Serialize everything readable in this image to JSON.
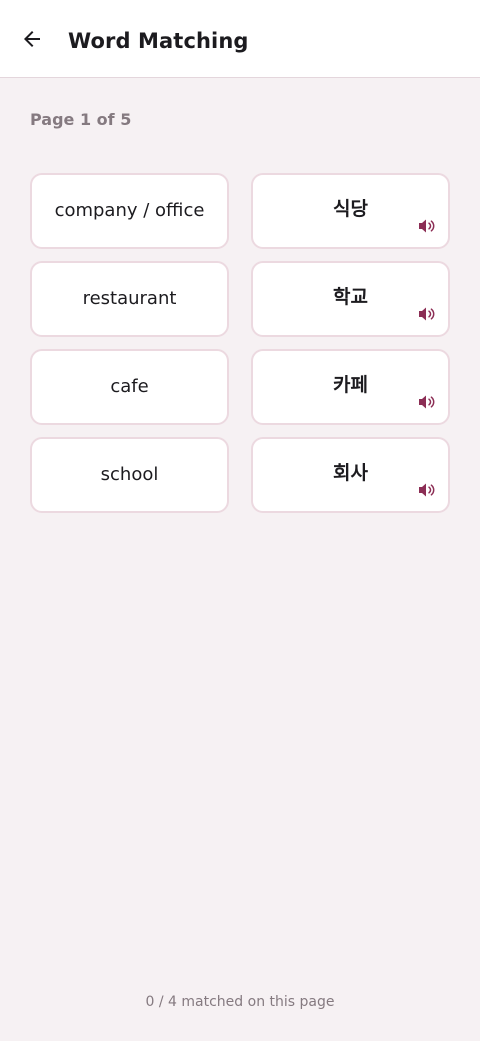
{
  "header": {
    "title": "Word Matching"
  },
  "page_indicator": "Page 1 of 5",
  "english_words": [
    "company / office",
    "restaurant",
    "cafe",
    "school"
  ],
  "korean_words": [
    "식당",
    "학교",
    "카페",
    "회사"
  ],
  "footer": {
    "status": "0 / 4 matched on this page"
  },
  "colors": {
    "background": "#f6f1f3",
    "card_border": "#ecd9e0",
    "accent": "#8c2e55",
    "muted_text": "#857a80"
  },
  "icons": {
    "back": "arrow-back-icon",
    "speaker": "volume-up-icon"
  }
}
